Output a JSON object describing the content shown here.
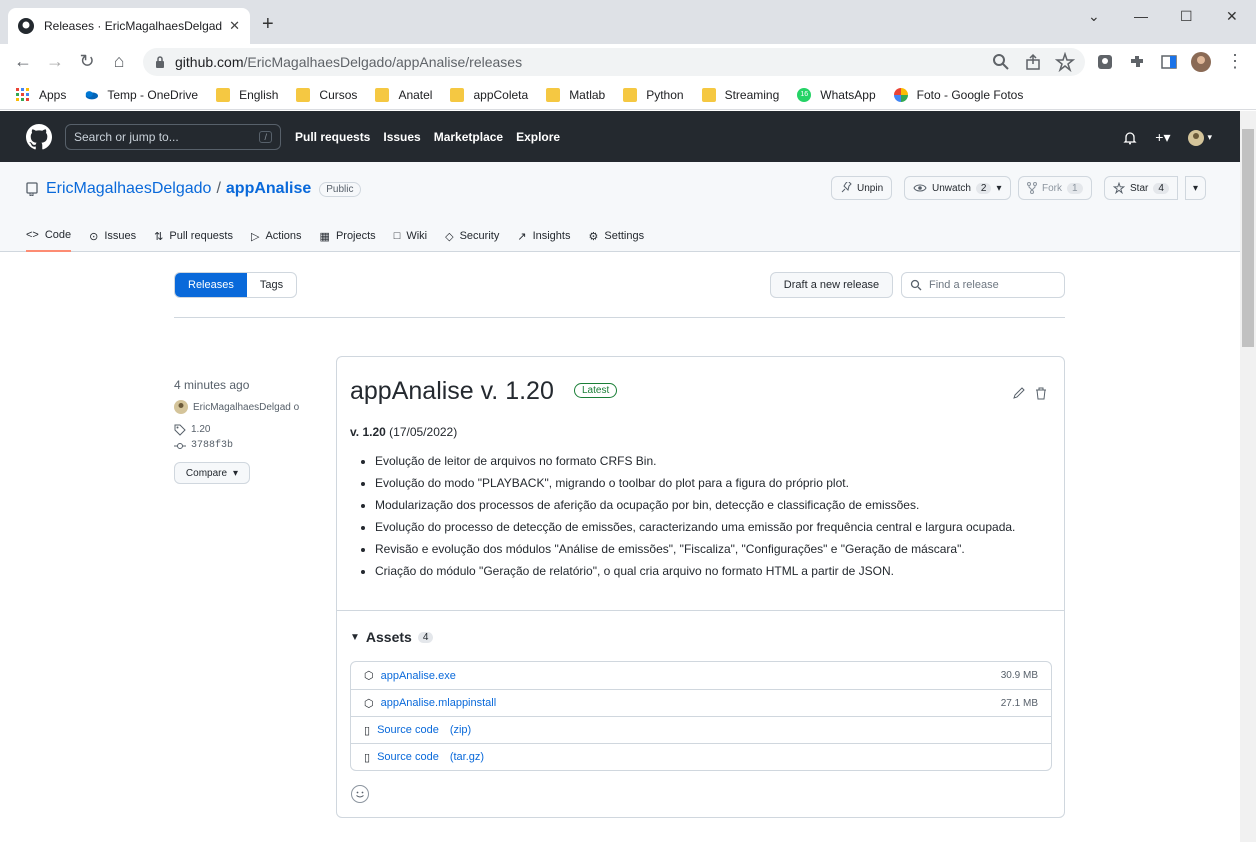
{
  "browser": {
    "tab_title": "Releases · EricMagalhaesDelgado",
    "url_host": "github.com",
    "url_path": "/EricMagalhaesDelgado/appAnalise/releases",
    "bookmarks": [
      "Apps",
      "Temp - OneDrive",
      "English",
      "Cursos",
      "Anatel",
      "appColeta",
      "Matlab",
      "Python",
      "Streaming",
      "WhatsApp",
      "Foto - Google Fotos"
    ],
    "whatsapp_badge": "16"
  },
  "gh": {
    "search_placeholder": "Search or jump to...",
    "search_key": "/",
    "nav": [
      "Pull requests",
      "Issues",
      "Marketplace",
      "Explore"
    ]
  },
  "repo": {
    "owner": "EricMagalhaesDelgado",
    "sep": "/",
    "name": "appAnalise",
    "visibility": "Public",
    "unpin": "Unpin",
    "unwatch": "Unwatch",
    "watch_count": "2",
    "fork": "Fork",
    "fork_count": "1",
    "star": "Star",
    "star_count": "4",
    "tabs": [
      "Code",
      "Issues",
      "Pull requests",
      "Actions",
      "Projects",
      "Wiki",
      "Security",
      "Insights",
      "Settings"
    ]
  },
  "releases": {
    "tab_releases": "Releases",
    "tab_tags": "Tags",
    "draft_button": "Draft a new release",
    "find_placeholder": "Find a release"
  },
  "release": {
    "ago": "4 minutes ago",
    "author": "EricMagalhaesDelgad o",
    "tag": "1.20",
    "commit": "3788f3b",
    "compare": "Compare",
    "title": "appAnalise v. 1.20",
    "badge": "Latest",
    "version_bold": "v. 1.20",
    "version_date": "(17/05/2022)",
    "notes": [
      "Evolução de leitor de arquivos no formato CRFS Bin.",
      "Evolução do modo \"PLAYBACK\", migrando o toolbar do plot para a figura do próprio plot.",
      "Modularização dos processos de aferição da ocupação por bin, detecção e classificação de emissões.",
      "Evolução do processo de detecção de emissões, caracterizando uma emissão por frequência central e largura ocupada.",
      "Revisão e evolução dos módulos \"Análise de emissões\", \"Fiscaliza\", \"Configurações\" e \"Geração de máscara\".",
      "Criação do módulo \"Geração de relatório\", o qual cria arquivo no formato HTML a partir de JSON."
    ],
    "assets_label": "Assets",
    "assets_count": "4",
    "assets": [
      {
        "name": "appAnalise.exe",
        "ext": "",
        "size": "30.9 MB"
      },
      {
        "name": "appAnalise.mlappinstall",
        "ext": "",
        "size": "27.1 MB"
      },
      {
        "name": "Source code",
        "ext": "(zip)",
        "size": ""
      },
      {
        "name": "Source code",
        "ext": "(tar.gz)",
        "size": ""
      }
    ]
  }
}
